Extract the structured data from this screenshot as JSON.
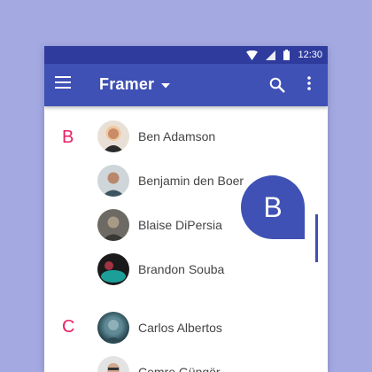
{
  "status_bar": {
    "time": "12:30",
    "icons": [
      "wifi-icon",
      "signal-icon",
      "battery-icon"
    ]
  },
  "app_bar": {
    "title": "Framer",
    "icons": [
      "menu-icon",
      "dropdown-icon",
      "search-icon",
      "more-vert-icon"
    ]
  },
  "sections": [
    {
      "letter": "B",
      "contacts": [
        "Ben Adamson",
        "Benjamin den Boer",
        "Blaise DiPersia",
        "Brandon Souba"
      ]
    },
    {
      "letter": "C",
      "contacts": [
        "Carlos Albertos",
        "Cemre Güngör"
      ]
    }
  ],
  "scroll_bubble": {
    "letter": "B"
  },
  "colors": {
    "background": "#a4a9e2",
    "status_bar": "#2f3c9e",
    "primary": "#3f51b5",
    "accent": "#e91e63"
  }
}
